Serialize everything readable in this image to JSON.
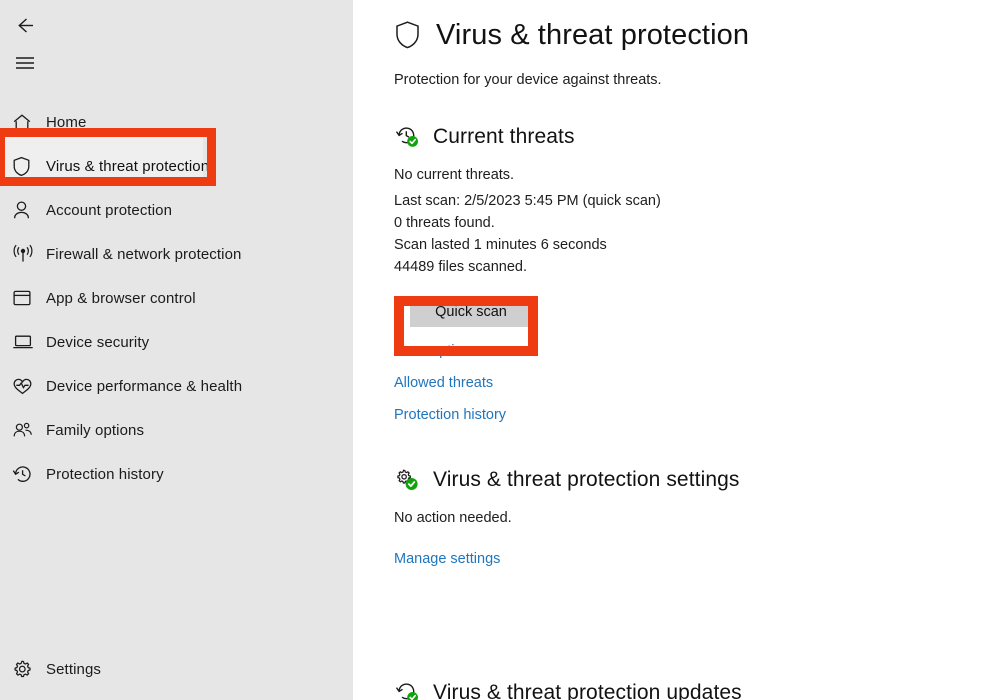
{
  "sidebar": {
    "back_icon": "back-arrow-icon",
    "menu_icon": "hamburger-menu-icon",
    "items": [
      {
        "label": "Home",
        "icon": "home-icon"
      },
      {
        "label": "Virus & threat protection",
        "icon": "shield-icon"
      },
      {
        "label": "Account protection",
        "icon": "person-icon"
      },
      {
        "label": "Firewall & network protection",
        "icon": "broadcast-icon"
      },
      {
        "label": "App & browser control",
        "icon": "window-icon"
      },
      {
        "label": "Device security",
        "icon": "laptop-icon"
      },
      {
        "label": "Device performance & health",
        "icon": "heart-pulse-icon"
      },
      {
        "label": "Family options",
        "icon": "people-group-icon"
      },
      {
        "label": "Protection history",
        "icon": "history-clock-icon"
      }
    ],
    "settings": {
      "label": "Settings",
      "icon": "gear-icon"
    }
  },
  "header": {
    "icon": "shield-outline-icon",
    "title": "Virus & threat protection",
    "subtitle": "Protection for your device against threats."
  },
  "current_threats": {
    "icon": "history-clock-check-icon",
    "title": "Current threats",
    "status": "No current threats.",
    "last_scan": "Last scan: 2/5/2023 5:45 PM (quick scan)",
    "threats_found": "0 threats found.",
    "scan_duration": "Scan lasted 1 minutes 6 seconds",
    "files_scanned": "44489 files scanned.",
    "scan_button": "Quick scan",
    "links": [
      "Scan options",
      "Allowed threats",
      "Protection history"
    ]
  },
  "protection_settings": {
    "icon": "gears-check-icon",
    "title": "Virus & threat protection settings",
    "status": "No action needed.",
    "link": "Manage settings"
  },
  "protection_updates": {
    "icon": "refresh-check-icon",
    "title": "Virus & threat protection updates"
  },
  "colors": {
    "annotation": "#ef3b11",
    "link": "#2076bd",
    "sidebar_bg": "#e6e6e6",
    "button_bg": "#cfcfcf",
    "badge_green": "#13a10e"
  }
}
